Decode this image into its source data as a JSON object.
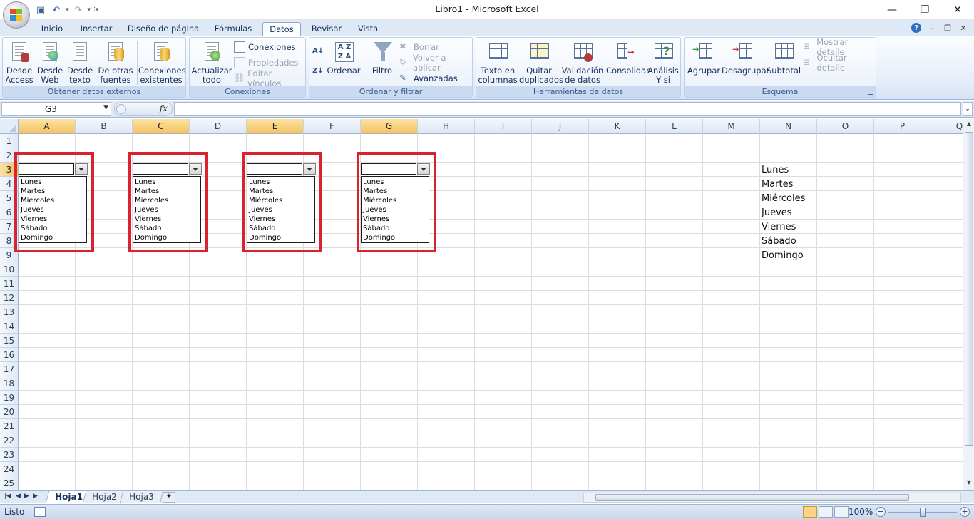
{
  "window": {
    "title": "Libro1 - Microsoft Excel",
    "controls": [
      "—",
      "❐",
      "✕"
    ]
  },
  "qat": {
    "save_icon": "save-icon",
    "undo_icon": "undo-icon",
    "redo_icon": "redo-icon"
  },
  "tabs": [
    "Inicio",
    "Insertar",
    "Diseño de página",
    "Fórmulas",
    "Datos",
    "Revisar",
    "Vista"
  ],
  "active_tab": "Datos",
  "ribbon": {
    "external": {
      "label": "Obtener datos externos",
      "access": "Desde\nAccess",
      "web": "Desde\nWeb",
      "text": "Desde\ntexto",
      "other": "De otras\nfuentes",
      "existing": "Conexiones\nexistentes"
    },
    "connections": {
      "label": "Conexiones",
      "refresh": "Actualizar\ntodo",
      "connections": "Conexiones",
      "properties": "Propiedades",
      "edit_links": "Editar vínculos"
    },
    "sort": {
      "label": "Ordenar y filtrar",
      "sort": "Ordenar",
      "filter": "Filtro",
      "clear": "Borrar",
      "reapply": "Volver a aplicar",
      "advanced": "Avanzadas"
    },
    "tools": {
      "label": "Herramientas de datos",
      "text_to_columns": "Texto en\ncolumnas",
      "remove_duplicates": "Quitar\nduplicados",
      "validation": "Validación\nde datos",
      "consolidate": "Consolidar",
      "whatif": "Análisis\nY si"
    },
    "outline": {
      "label": "Esquema",
      "group": "Agrupar",
      "ungroup": "Desagrupar",
      "subtotal": "Subtotal",
      "show_detail": "Mostrar detalle",
      "hide_detail": "Ocultar detalle"
    }
  },
  "formula_bar": {
    "name_box": "G3",
    "fx": "fx",
    "value": ""
  },
  "columns": [
    "A",
    "B",
    "C",
    "D",
    "E",
    "F",
    "G",
    "H",
    "I",
    "J",
    "K",
    "L",
    "M",
    "N",
    "O",
    "P",
    "Q"
  ],
  "selected_columns": [
    "A",
    "C",
    "E",
    "G"
  ],
  "rows": [
    "1",
    "2",
    "3",
    "4",
    "5",
    "6",
    "7",
    "8",
    "9",
    "10",
    "11",
    "12",
    "13",
    "14",
    "15",
    "16",
    "17",
    "18",
    "19",
    "20",
    "21",
    "22",
    "23",
    "24",
    "25"
  ],
  "selected_row": "3",
  "column_n_values": [
    "Lunes",
    "Martes",
    "Miércoles",
    "Jueves",
    "Viernes",
    "Sábado",
    "Domingo"
  ],
  "combo_controls": [
    {
      "value": "",
      "items": [
        "Lunes",
        "Martes",
        "Miércoles",
        "Jueves",
        "Viernes",
        "Sábado",
        "Domingo"
      ]
    },
    {
      "value": "",
      "items": [
        "Lunes",
        "Martes",
        "Miércoles",
        "Jueves",
        "Viernes",
        "Sábado",
        "Domingo"
      ]
    },
    {
      "value": "",
      "items": [
        "Lunes",
        "Martes",
        "Miércoles",
        "Jueves",
        "Viernes",
        "Sábado",
        "Domingo"
      ]
    },
    {
      "value": "",
      "items": [
        "Lunes",
        "Martes",
        "Miércoles",
        "Jueves",
        "Viernes",
        "Sábado",
        "Domingo"
      ]
    }
  ],
  "sheets": [
    "Hoja1",
    "Hoja2",
    "Hoja3"
  ],
  "active_sheet": "Hoja1",
  "status": {
    "text": "Listo",
    "zoom": "100%",
    "zoom_out": "−",
    "zoom_in": "+"
  },
  "colors": {
    "highlight": "#d9232e",
    "selection": "#f7c25d",
    "ribbon": "#dfe8f5"
  }
}
